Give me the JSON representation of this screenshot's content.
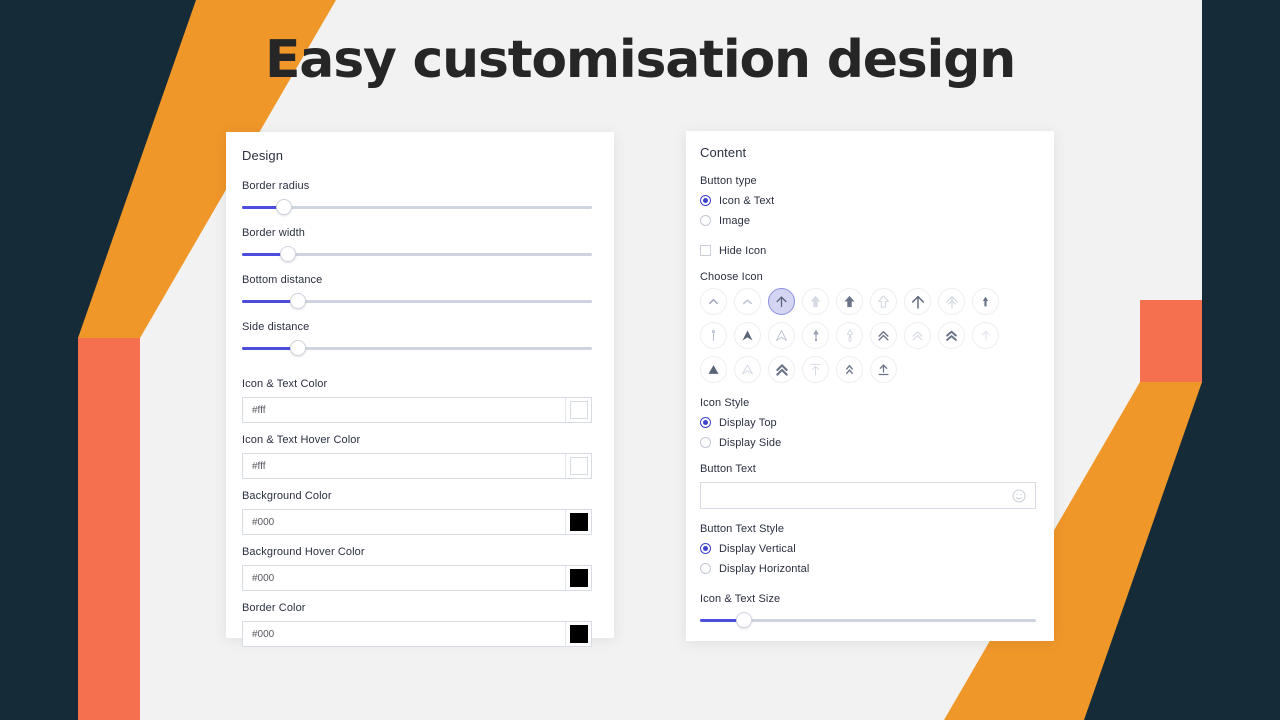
{
  "page": {
    "title": "Easy customisation design",
    "background_color": "#f2f2f2",
    "accent_orange": "#f0972a",
    "accent_coral": "#f4704f",
    "accent_navy": "#162b38",
    "accent_indigo": "#4c4ddc"
  },
  "design_panel": {
    "title": "Design",
    "sliders": [
      {
        "label": "Border radius",
        "percent": 12
      },
      {
        "label": "Border width",
        "percent": 13
      },
      {
        "label": "Bottom distance",
        "percent": 16
      },
      {
        "label": "Side distance",
        "percent": 16
      }
    ],
    "colors": [
      {
        "label": "Icon & Text Color",
        "value": "#fff",
        "swatch": "#ffffff"
      },
      {
        "label": "Icon & Text Hover Color",
        "value": "#fff",
        "swatch": "#ffffff"
      },
      {
        "label": "Background Color",
        "value": "#000",
        "swatch": "#000000"
      },
      {
        "label": "Background Hover Color",
        "value": "#000",
        "swatch": "#000000"
      },
      {
        "label": "Border Color",
        "value": "#000",
        "swatch": "#000000"
      }
    ]
  },
  "content_panel": {
    "title": "Content",
    "button_type": {
      "label": "Button type",
      "options": [
        {
          "label": "Icon & Text",
          "selected": true
        },
        {
          "label": "Image",
          "selected": false
        }
      ]
    },
    "hide_icon": {
      "label": "Hide Icon",
      "checked": false
    },
    "choose_icon": {
      "label": "Choose Icon",
      "selected_index": 2,
      "icons": [
        {
          "name": "chevron-up-thin-icon",
          "glyph": "chevron-thin"
        },
        {
          "name": "chevron-up-soft-icon",
          "glyph": "chevron-soft"
        },
        {
          "name": "arrow-up-circle-outline-icon",
          "glyph": "arrow-line"
        },
        {
          "name": "arrow-up-solid-light-icon",
          "glyph": "arrow-solid-light"
        },
        {
          "name": "arrow-up-solid-icon",
          "glyph": "arrow-solid"
        },
        {
          "name": "arrow-up-outline-icon",
          "glyph": "arrow-outline"
        },
        {
          "name": "arrow-up-bold-icon",
          "glyph": "arrow-bold"
        },
        {
          "name": "arrow-up-double-outline-icon",
          "glyph": "arrow-double-outline"
        },
        {
          "name": "arrow-up-narrow-icon",
          "glyph": "arrow-narrow"
        },
        {
          "name": "arrow-up-pin-icon",
          "glyph": "arrow-pin"
        },
        {
          "name": "triangle-up-solid-icon",
          "glyph": "triangle-solid"
        },
        {
          "name": "triangle-up-outline-icon",
          "glyph": "triangle-outline"
        },
        {
          "name": "arrow-up-pill-icon",
          "glyph": "arrow-pill"
        },
        {
          "name": "arrow-up-capsule-icon",
          "glyph": "arrow-capsule"
        },
        {
          "name": "chevron-double-up-icon",
          "glyph": "chevron-double"
        },
        {
          "name": "chevron-double-up-thin-icon",
          "glyph": "chevron-double-thin"
        },
        {
          "name": "chevron-double-up-bold-icon",
          "glyph": "chevron-double-bold"
        },
        {
          "name": "arrow-up-faint-icon",
          "glyph": "arrow-faint"
        },
        {
          "name": "triangle-up-filled-icon",
          "glyph": "triangle-filled"
        },
        {
          "name": "triangle-up-line-icon",
          "glyph": "triangle-line"
        },
        {
          "name": "chevron-double-up-solid-icon",
          "glyph": "chevron-double-solid"
        },
        {
          "name": "arrow-up-to-line-icon",
          "glyph": "arrow-to-line"
        },
        {
          "name": "chevron-double-up-small-icon",
          "glyph": "chevron-double-small"
        },
        {
          "name": "upload-to-line-icon",
          "glyph": "upload-line"
        }
      ]
    },
    "icon_style": {
      "label": "Icon Style",
      "options": [
        {
          "label": "Display Top",
          "selected": true
        },
        {
          "label": "Display Side",
          "selected": false
        }
      ]
    },
    "button_text": {
      "label": "Button Text",
      "value": "",
      "placeholder": ""
    },
    "button_text_style": {
      "label": "Button Text Style",
      "options": [
        {
          "label": "Display Vertical",
          "selected": true
        },
        {
          "label": "Display Horizontal",
          "selected": false
        }
      ]
    },
    "icon_text_size": {
      "label": "Icon & Text Size",
      "percent": 13
    }
  }
}
